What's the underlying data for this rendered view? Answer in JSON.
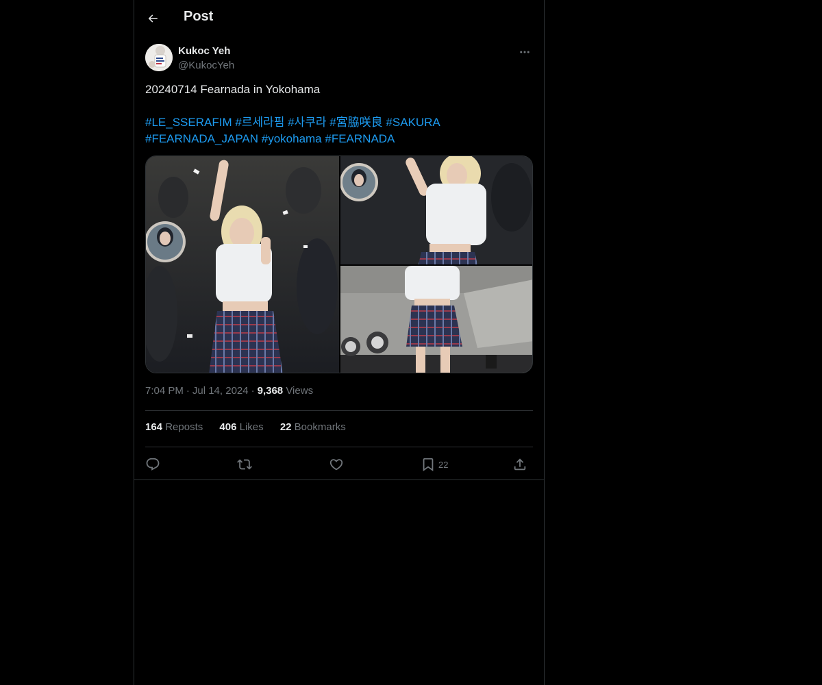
{
  "header": {
    "title": "Post"
  },
  "author": {
    "display_name": "Kukoc Yeh",
    "handle": "@KukocYeh"
  },
  "tweet": {
    "text": "20240714 Fearnada in Yokohama",
    "hashtags_line1": [
      "#LE_SSERAFIM",
      "#르세라핌",
      "#사쿠라",
      "#宮脇咲良",
      "#SAKURA"
    ],
    "hashtags_line2": [
      "#FEARNADA_JAPAN",
      "#yokohama",
      "#FEARNADA"
    ]
  },
  "meta": {
    "time": "7:04 PM",
    "date": "Jul 14, 2024",
    "views_count": "9,368",
    "views_label": "Views"
  },
  "stats": {
    "reposts_count": "164",
    "reposts_label": "Reposts",
    "likes_count": "406",
    "likes_label": "Likes",
    "bookmarks_count": "22",
    "bookmarks_label": "Bookmarks"
  },
  "actions": {
    "reply_icon": "reply-icon",
    "repost_icon": "repost-icon",
    "like_icon": "heart-icon",
    "bookmark_icon": "bookmark-icon",
    "bookmark_count": "22",
    "share_icon": "share-icon"
  },
  "colors": {
    "background": "#000000",
    "text": "#e7e9ea",
    "secondary_text": "#71767b",
    "link": "#1d9bf0",
    "border": "#2f3336"
  }
}
